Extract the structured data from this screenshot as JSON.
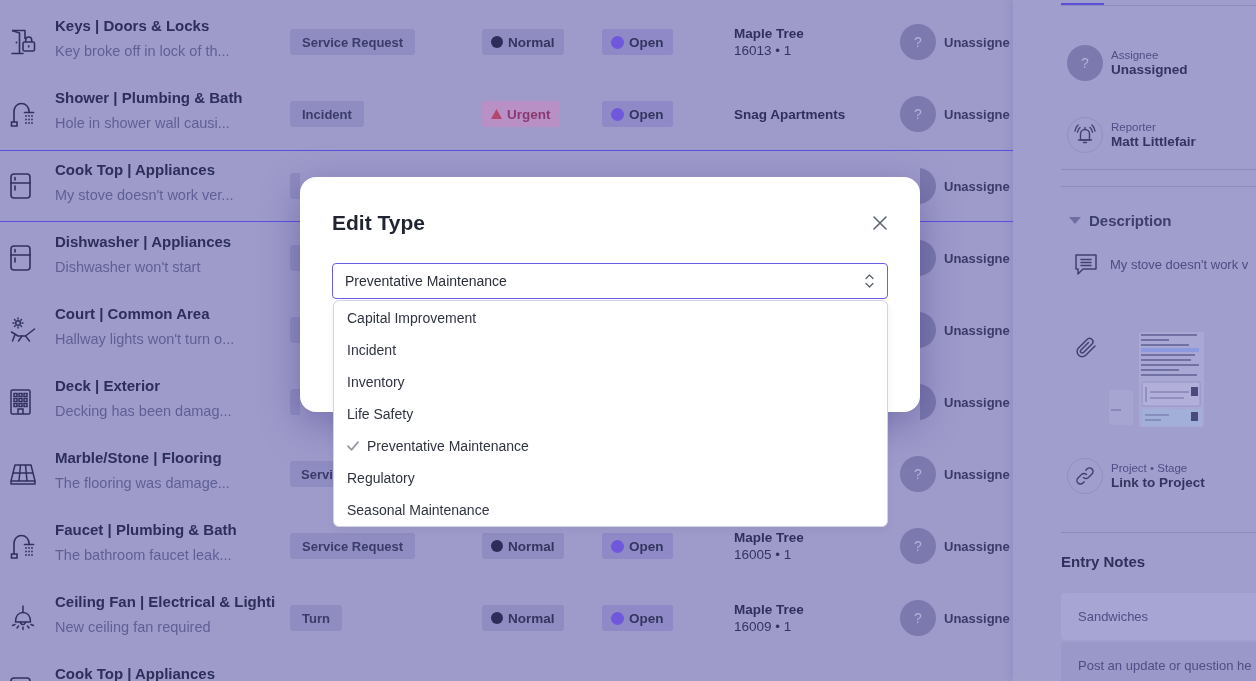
{
  "rows": [
    {
      "kind": "door_lock",
      "title": "Keys | Doors & Locks",
      "subtitle": "Key broke off in lock of th...",
      "tag": "Service Request",
      "priority": {
        "label": "Normal",
        "kind": "normal"
      },
      "status": {
        "label": "Open",
        "kind": "open"
      },
      "location": "Maple Tree",
      "unit": "16013 • 1",
      "avatar": "?",
      "assignee": "Unassigne",
      "selected": false
    },
    {
      "kind": "faucet",
      "title": "Shower | Plumbing & Bath",
      "subtitle": "Hole in shower wall causi...",
      "tag": "Incident",
      "priority": {
        "label": "Urgent",
        "kind": "urgent"
      },
      "status": {
        "label": "Open",
        "kind": "open"
      },
      "location": "Snag Apartments",
      "avatar": "?",
      "assignee": "Unassigne",
      "selected": false
    },
    {
      "kind": "fridge",
      "title": "Cook Top | Appliances",
      "subtitle": "My stove doesn't work ver...",
      "tag_covered": true,
      "avatar_covered": true,
      "assignee": "Unassigne",
      "selected": true
    },
    {
      "kind": "fridge",
      "title": "Dishwasher | Appliances",
      "subtitle": "Dishwasher won't start",
      "tag_covered": true,
      "avatar_covered": true,
      "assignee": "Unassigne",
      "selected": false
    },
    {
      "kind": "lounger",
      "title": "Court | Common Area",
      "subtitle": "Hallway lights won't turn o...",
      "tag_covered": true,
      "avatar_covered": true,
      "assignee": "Unassigne",
      "selected": false
    },
    {
      "kind": "building",
      "title": "Deck | Exterior",
      "subtitle": "Decking has been damag...",
      "tag_covered": true,
      "avatar_covered": true,
      "assignee": "Unassigne",
      "selected": false
    },
    {
      "kind": "floor_tiles",
      "title": "Marble/Stone | Flooring",
      "subtitle": "The flooring was damage...",
      "tag": "Servi",
      "tag_cut": true,
      "avatar": "?",
      "assignee": "Unassigne",
      "selected": false
    },
    {
      "kind": "faucet",
      "title": "Faucet | Plumbing & Bath",
      "subtitle": "The bathroom faucet leak...",
      "tag": "Service Request",
      "priority": {
        "label": "Normal",
        "kind": "normal"
      },
      "status": {
        "label": "Open",
        "kind": "open"
      },
      "location": "Maple Tree",
      "unit": "16005 • 1",
      "avatar": "?",
      "assignee": "Unassigne",
      "selected": false
    },
    {
      "kind": "ceiling_lamp",
      "title": "Ceiling Fan | Electrical & Lighti",
      "subtitle": "New ceiling fan required",
      "tag": "Turn",
      "priority": {
        "label": "Normal",
        "kind": "normal"
      },
      "status": {
        "label": "Open",
        "kind": "open"
      },
      "location": "Maple Tree",
      "unit": "16009 • 1",
      "avatar": "?",
      "assignee": "Unassigne",
      "selected": false
    },
    {
      "kind": "fridge",
      "title": "Cook Top | Appliances",
      "selected": false
    }
  ],
  "modal": {
    "title": "Edit Type",
    "select": {
      "value": "Preventative Maintenance"
    },
    "options": [
      {
        "label": "Capital Improvement",
        "selected": false
      },
      {
        "label": "Incident",
        "selected": false
      },
      {
        "label": "Inventory",
        "selected": false
      },
      {
        "label": "Life Safety",
        "selected": false
      },
      {
        "label": "Preventative Maintenance",
        "selected": true
      },
      {
        "label": "Regulatory",
        "selected": false
      },
      {
        "label": "Seasonal Maintenance",
        "selected": false
      }
    ]
  },
  "detail_panel": {
    "assignee": {
      "avatar": "?",
      "label": "Assignee",
      "value": "Unassigned"
    },
    "reporter": {
      "label": "Reporter",
      "value": "Matt Littlefair"
    },
    "description": {
      "heading": "Description",
      "expanded": true,
      "text": "My stove doesn't work v"
    },
    "project": {
      "label": "Project • Stage",
      "value": "Link to Project"
    },
    "entry_notes": {
      "heading": "Entry Notes",
      "fields": [
        {
          "placeholder": "Sandwiches"
        },
        {
          "placeholder": "Post an update or question he"
        }
      ]
    }
  }
}
